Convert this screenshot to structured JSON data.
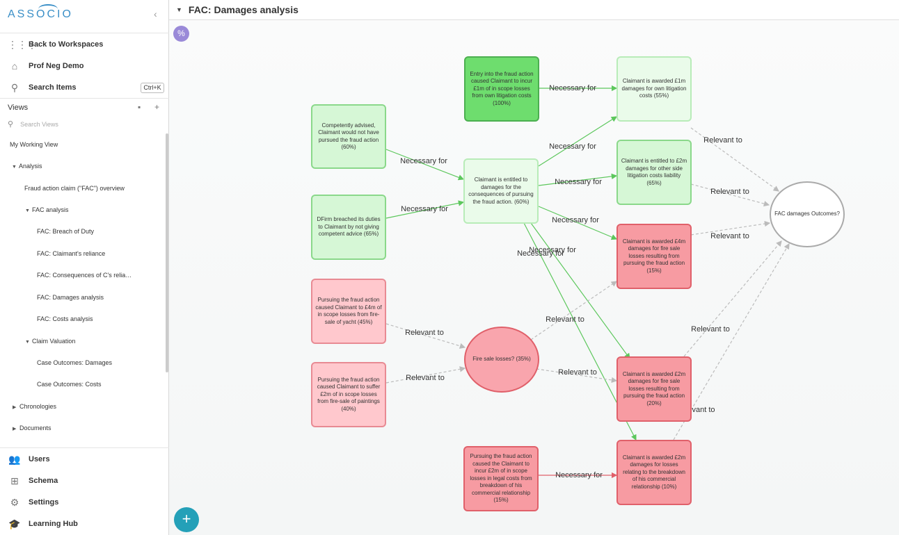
{
  "sidebar": {
    "logo": "ASSOCIO",
    "collapse_icon": "chevron-left-icon",
    "back": "Back to Workspaces",
    "workspace": "Prof Neg Demo",
    "search": "Search Items",
    "search_shortcut": "Ctrl+K",
    "views_heading": "Views",
    "search_views_placeholder": "Search Views",
    "my_view": "My Working View",
    "tree": {
      "analysis": "Analysis",
      "fac_overview": "Fraud action claim (\"FAC\") overview",
      "fac_analysis": "FAC analysis",
      "breach": "FAC: Breach of Duty",
      "reliance": "FAC: Claimant's reliance",
      "consequences": "FAC: Consequences of C's relia…",
      "damages": "FAC: Damages analysis",
      "costs": "FAC: Costs analysis",
      "claim_valuation": "Claim Valuation",
      "outcomes_damages": "Case Outcomes: Damages",
      "outcomes_costs": "Case Outcomes: Costs",
      "chronologies": "Chronologies",
      "documents": "Documents"
    },
    "footer": {
      "users": "Users",
      "schema": "Schema",
      "settings": "Settings",
      "learning": "Learning Hub"
    }
  },
  "header": {
    "title": "FAC: Damages analysis"
  },
  "canvas": {
    "pct_label": "%",
    "add_label": "+"
  },
  "nodes": {
    "entry": "Entry into the fraud action caused Claimant to incur £1m of in scope losses from own litigation costs (100%)",
    "awarded1m": "Claimant is awarded £1m damages for own litigation costs (55%)",
    "competently": "Competently advised, Claimant would not have pursued the fraud action (60%)",
    "entitled": "Claimant is entitled to damages for the consequences of pursuing the fraud action. (60%)",
    "entitled2m": "Claimant is entitled to £2m damages for other side litigation costs liability (65%)",
    "dfirm": "DFirm breached its duties to Claimant by not giving competent advice (65%)",
    "outcomes": "FAC damages Outcomes?",
    "awarded4m": "Claimant is awarded £4m damages for fire sale losses resulting from pursuing the fraud action (15%)",
    "yacht": "Pursuing the fraud action caused Claimant to £4m of in scope losses from fire-sale of yacht (45%)",
    "firesale": "Fire sale losses? (35%)",
    "paintings": "Pursuing the fraud action caused Claimant to suffer £2m of in scope losses from fire-sale of paintings (40%)",
    "awarded2m_fire": "Claimant is awarded £2m damages for fire sale losses resulting from pursuing the fraud action (20%)",
    "legal": "Pursuing the fraud action caused the Claimant to incur £2m of in scope losses in legal costs from breakdown of his commercial relationship (15%)",
    "awarded2m_comm": "Claimant is awarded £2m damages for losses relating to the breakdown of his commercial relationship (10%)"
  },
  "edge_labels": {
    "necessary": "Necessary for",
    "relevant": "Relevant to",
    "partial_relevant": "vant to"
  },
  "colors": {
    "necessary_edge": "#5cc75c",
    "relevant_edge": "#bbbbbb",
    "accent": "#24a0b8"
  }
}
